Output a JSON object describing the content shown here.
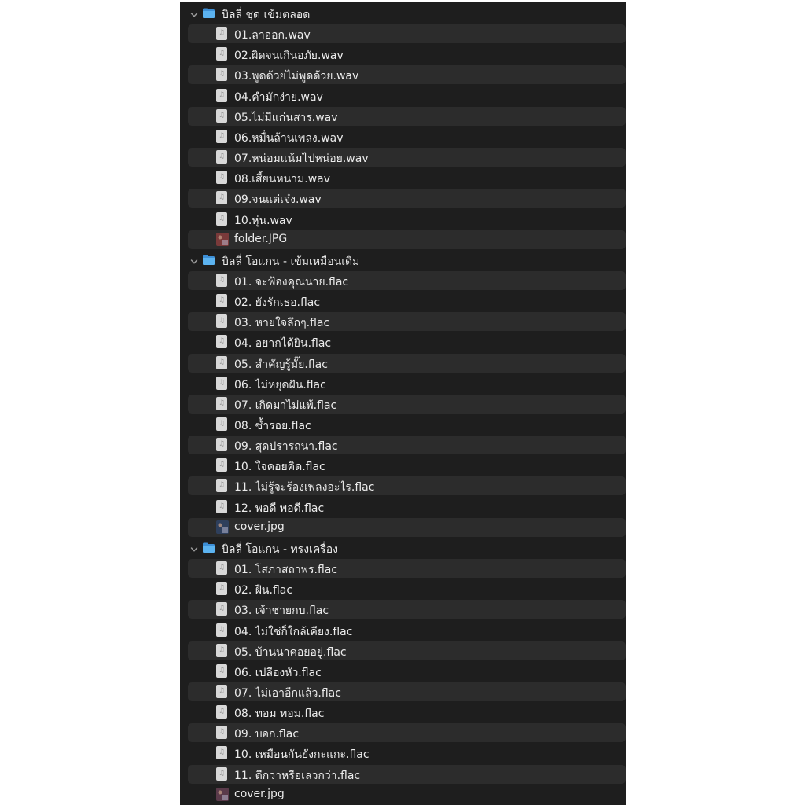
{
  "colors": {
    "panel_bg": "#1e1e1e",
    "stripe": "#2c2c2c",
    "text": "#ebebeb",
    "folder_blue": "#4ba3e8"
  },
  "folders": [
    {
      "name": "บิลลี่ ชุด เข้มตลอด",
      "expanded": true,
      "icon": "folder-icon",
      "files": [
        {
          "name": "01.ลาออก.wav",
          "icon": "audio-file-icon"
        },
        {
          "name": "02.ผิดจนเกินอภัย.wav",
          "icon": "audio-file-icon"
        },
        {
          "name": "03.พูดด้วยไม่พูดด้วย.wav",
          "icon": "audio-file-icon"
        },
        {
          "name": "04.คำมักง่าย.wav",
          "icon": "audio-file-icon"
        },
        {
          "name": "05.ไม่มีแก่นสาร.wav",
          "icon": "audio-file-icon"
        },
        {
          "name": "06.หมื่นล้านเพลง.wav",
          "icon": "audio-file-icon"
        },
        {
          "name": "07.หน่อมแน้มไปหน่อย.wav",
          "icon": "audio-file-icon"
        },
        {
          "name": "08.เสี้ยนหนาม.wav",
          "icon": "audio-file-icon"
        },
        {
          "name": "09.จนแต่เจ๋ง.wav",
          "icon": "audio-file-icon"
        },
        {
          "name": "10.หุ่น.wav",
          "icon": "audio-file-icon"
        },
        {
          "name": "folder.JPG",
          "icon": "image-thumbnail-icon",
          "thumb": "#7a3a3a"
        }
      ]
    },
    {
      "name": "บิลลี่ โอแกน - เข้มเหมือนเดิม",
      "expanded": true,
      "icon": "folder-icon",
      "files": [
        {
          "name": "01. จะฟ้องคุณนาย.flac",
          "icon": "audio-file-icon"
        },
        {
          "name": "02. ยังรักเธอ.flac",
          "icon": "audio-file-icon"
        },
        {
          "name": "03. หายใจลึกๆ.flac",
          "icon": "audio-file-icon"
        },
        {
          "name": "04. อยากได้ยิน.flac",
          "icon": "audio-file-icon"
        },
        {
          "name": "05. สำคัญรู้มั๊ย.flac",
          "icon": "audio-file-icon"
        },
        {
          "name": "06. ไม่หยุดฝัน.flac",
          "icon": "audio-file-icon"
        },
        {
          "name": "07. เกิดมาไม่แพ้.flac",
          "icon": "audio-file-icon"
        },
        {
          "name": "08. ซ้ำรอย.flac",
          "icon": "audio-file-icon"
        },
        {
          "name": "09. สุดปรารถนา.flac",
          "icon": "audio-file-icon"
        },
        {
          "name": "10. ใจคอยคิด.flac",
          "icon": "audio-file-icon"
        },
        {
          "name": "11. ไม่รู้จะร้องเพลงอะไร.flac",
          "icon": "audio-file-icon"
        },
        {
          "name": "12. พอดี พอดี.flac",
          "icon": "audio-file-icon"
        },
        {
          "name": "cover.jpg",
          "icon": "image-thumbnail-icon",
          "thumb": "#2e3f5c"
        }
      ]
    },
    {
      "name": "บิลลี่ โอแกน - ทรงเครื่อง",
      "expanded": true,
      "icon": "folder-icon",
      "files": [
        {
          "name": "01. โสภาสถาพร.flac",
          "icon": "audio-file-icon"
        },
        {
          "name": "02. ฝืน.flac",
          "icon": "audio-file-icon"
        },
        {
          "name": "03. เจ้าชายกบ.flac",
          "icon": "audio-file-icon"
        },
        {
          "name": "04. ไม่ใช่ก็ใกล้เคียง.flac",
          "icon": "audio-file-icon"
        },
        {
          "name": "05. บ้านนาคอยอยู่.flac",
          "icon": "audio-file-icon"
        },
        {
          "name": "06. เปลืองหัว.flac",
          "icon": "audio-file-icon"
        },
        {
          "name": "07. ไม่เอาอีกแล้ว.flac",
          "icon": "audio-file-icon"
        },
        {
          "name": "08. ทอม ทอม.flac",
          "icon": "audio-file-icon"
        },
        {
          "name": "09. บอก.flac",
          "icon": "audio-file-icon"
        },
        {
          "name": "10. เหมือนกันยังกะแกะ.flac",
          "icon": "audio-file-icon"
        },
        {
          "name": "11. ดีกว่าหรือเลวกว่า.flac",
          "icon": "audio-file-icon"
        },
        {
          "name": "cover.jpg",
          "icon": "image-thumbnail-icon",
          "thumb": "#5a3a4a"
        }
      ]
    }
  ]
}
